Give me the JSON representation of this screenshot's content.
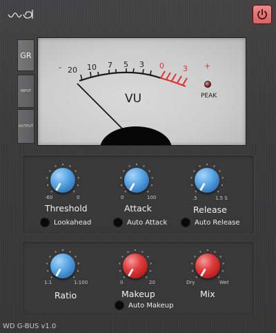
{
  "header": {
    "logo_icon": "wd-logo-icon",
    "power_icon": "power-icon",
    "power_color": "#e27272"
  },
  "tabs": [
    {
      "label": "GR",
      "active": true
    },
    {
      "label": "INPUT",
      "active": false
    },
    {
      "label": "OUTPUT",
      "active": false
    }
  ],
  "meter": {
    "scale_labels": [
      "-",
      "20",
      "10",
      "7",
      "5",
      "3",
      "1",
      "0",
      "1",
      "3",
      "+"
    ],
    "unit": "VU",
    "peak_label": "PEAK",
    "needle_angle_label": "rest"
  },
  "row1": {
    "threshold": {
      "label": "Threshold",
      "min": "-60",
      "max": "0"
    },
    "attack": {
      "label": "Attack",
      "min": "0",
      "max": "100"
    },
    "release": {
      "label": "Release",
      "min": ".5",
      "max": "1.5 S"
    },
    "lookahead": "Lookahead",
    "auto_attack": "Auto Attack",
    "auto_release": "Auto Release"
  },
  "row2": {
    "ratio": {
      "label": "Ratio",
      "min": "1:1",
      "max": "1:100"
    },
    "makeup": {
      "label": "Makeup",
      "min": "0",
      "max": "20"
    },
    "mix": {
      "label": "Mix",
      "min": "Dry",
      "max": "Wet"
    },
    "auto_makeup": "Auto Makeup"
  },
  "footer": {
    "version": "WD G-BUS v1.0"
  },
  "colors": {
    "knob_blue": "#4a93d6",
    "knob_red": "#d22b2b",
    "meter_red": "#e03030",
    "bg": "#3a3a3b"
  }
}
